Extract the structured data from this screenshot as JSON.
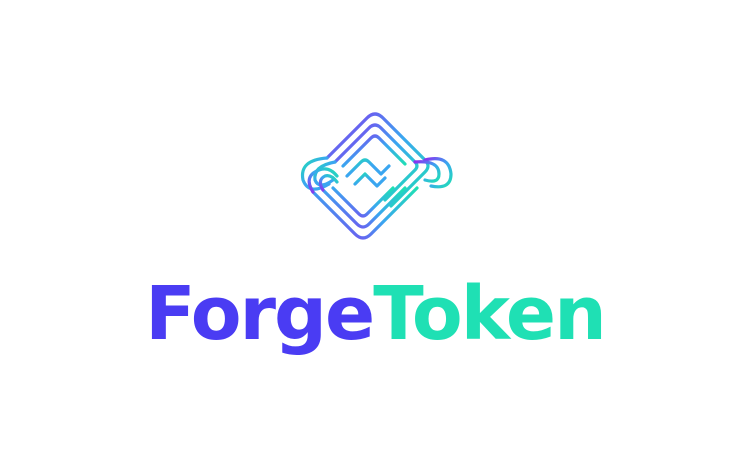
{
  "brand": {
    "name_part_1": "Forge",
    "name_part_2": "Token"
  },
  "colors": {
    "primary_purple": "#4a3cf3",
    "primary_teal": "#1fe0b4",
    "mark_gradient_start": "#8a2ff0",
    "mark_gradient_mid": "#3aa6f0",
    "mark_gradient_end": "#1fe0b4",
    "background": "#ffffff"
  },
  "icons": {
    "logo_mark": "interlocking-chain-links-diamond-icon"
  }
}
